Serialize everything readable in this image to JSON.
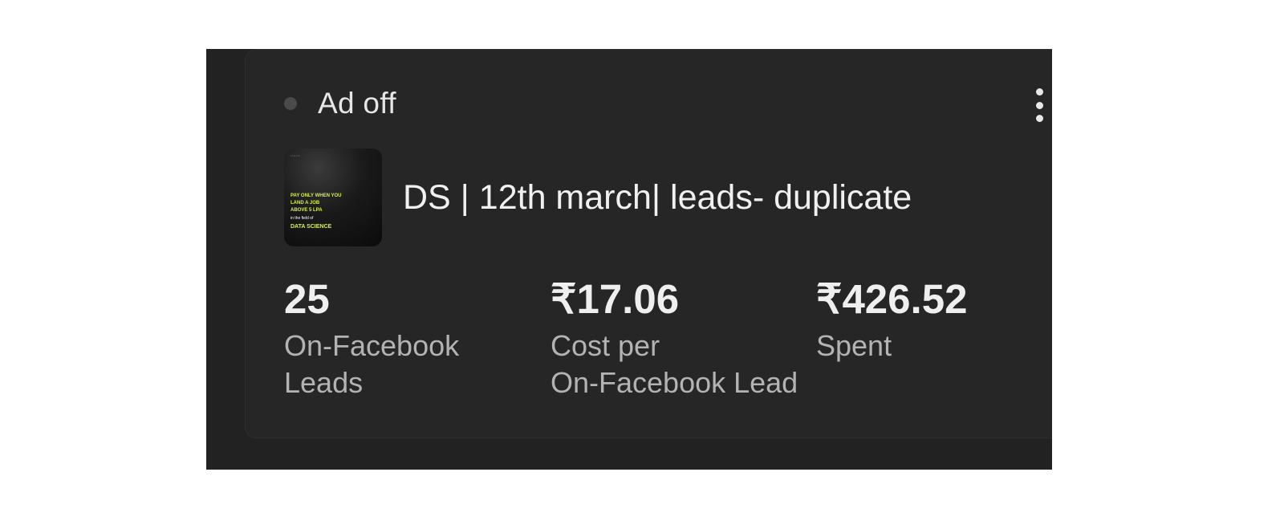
{
  "ad_card": {
    "status": {
      "label": "Ad off",
      "dot_color": "#4b4b4b"
    },
    "menu": {
      "icon": "more-vertical-icon"
    },
    "ad": {
      "name": "DS | 12th march| leads- duplicate",
      "thumbnail": {
        "line1": "PAY ONLY WHEN YOU",
        "line2": "LAND A JOB",
        "line3": "ABOVE 5 LPA",
        "line4": "in the field of",
        "line5": "DATA SCIENCE",
        "accent_color": "#d6f04a"
      }
    },
    "metrics": [
      {
        "value": "25",
        "label_line1": "On-Facebook",
        "label_line2": "Leads"
      },
      {
        "value": "₹17.06",
        "label_line1": "Cost per",
        "label_line2": "On-Facebook Lead"
      },
      {
        "value": "₹426.52",
        "label_line1": "Spent",
        "label_line2": ""
      }
    ]
  },
  "colors": {
    "background": "#222222",
    "card": "#262626",
    "text_primary": "#efefef",
    "text_secondary": "#b3b3b3"
  }
}
